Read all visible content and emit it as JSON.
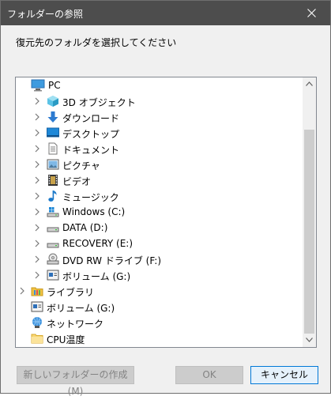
{
  "window": {
    "title": "フォルダーの参照"
  },
  "prompt": "復元先のフォルダを選択してください",
  "tree": [
    {
      "label": "PC",
      "icon": "pc-icon",
      "chevron": "expanded"
    },
    {
      "label": "3D オブジェクト",
      "icon": "3d-objects-icon",
      "chevron": "collapsed"
    },
    {
      "label": "ダウンロード",
      "icon": "downloads-icon",
      "chevron": "collapsed"
    },
    {
      "label": "デスクトップ",
      "icon": "desktop-icon",
      "chevron": "collapsed"
    },
    {
      "label": "ドキュメント",
      "icon": "documents-icon",
      "chevron": "collapsed"
    },
    {
      "label": "ピクチャ",
      "icon": "pictures-icon",
      "chevron": "collapsed"
    },
    {
      "label": "ビデオ",
      "icon": "videos-icon",
      "chevron": "collapsed"
    },
    {
      "label": "ミュージック",
      "icon": "music-icon",
      "chevron": "collapsed"
    },
    {
      "label": "Windows (C:)",
      "icon": "windows-drive-icon",
      "chevron": "collapsed"
    },
    {
      "label": "DATA (D:)",
      "icon": "drive-icon",
      "chevron": "collapsed"
    },
    {
      "label": "RECOVERY (E:)",
      "icon": "drive-icon",
      "chevron": "collapsed"
    },
    {
      "label": "DVD RW ドライブ (F:)",
      "icon": "dvd-drive-icon",
      "chevron": "collapsed"
    },
    {
      "label": "ボリューム (G:)",
      "icon": "volume-icon",
      "chevron": "collapsed"
    },
    {
      "label": "ライブラリ",
      "icon": "library-icon",
      "chevron": "collapsed"
    },
    {
      "label": "ボリューム (G:)",
      "icon": "volume-icon",
      "chevron": "none"
    },
    {
      "label": "ネットワーク",
      "icon": "network-icon",
      "chevron": "none"
    },
    {
      "label": "CPU温度",
      "icon": "folder-icon",
      "chevron": "none"
    }
  ],
  "buttons": {
    "new_folder": "新しいフォルダーの作成(M)",
    "ok": "OK",
    "cancel": "キャンセル"
  },
  "colors": {
    "titlebar": "#4d4d4d",
    "accent": "#0078d7"
  }
}
